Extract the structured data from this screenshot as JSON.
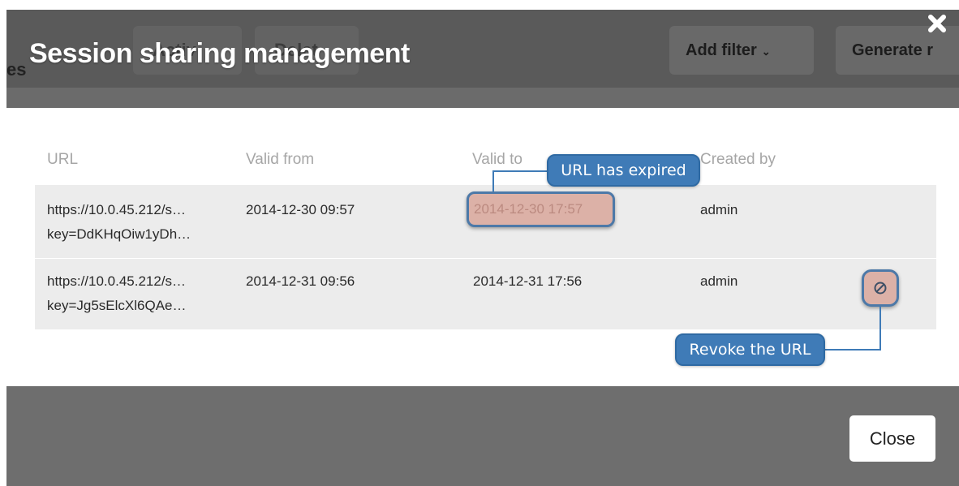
{
  "background_toolbar": {
    "tab_fragment": "es",
    "button_1": "Activ",
    "button_2": "Delet",
    "add_filter_label": "Add filter",
    "generate_label": "Generate r"
  },
  "dialog": {
    "title": "Session sharing management",
    "close_icon": "close-icon",
    "close_button_label": "Close"
  },
  "table": {
    "headers": {
      "url": "URL",
      "valid_from": "Valid from",
      "valid_to": "Valid to",
      "created_by": "Created by"
    },
    "rows": [
      {
        "url_line1": "https://10.0.45.212/s…",
        "url_line2": "key=DdKHqOiw1yDh…",
        "valid_from": "2014-12-30 09:57",
        "valid_to": "2014-12-30 17:57",
        "created_by": "admin",
        "expired": true
      },
      {
        "url_line1": "https://10.0.45.212/s…",
        "url_line2": "key=Jg5sElcXl6QAe…",
        "valid_from": "2014-12-31 09:56",
        "valid_to": "2014-12-31 17:56",
        "created_by": "admin",
        "expired": false,
        "revoke_icon": "revoke-icon"
      }
    ]
  },
  "callouts": {
    "expired": "URL has expired",
    "revoke": "Revoke the URL"
  },
  "colors": {
    "callout_blue": "#3f7bb7",
    "highlight": "#dcb1a7",
    "overlay": "#6b6b6b"
  }
}
